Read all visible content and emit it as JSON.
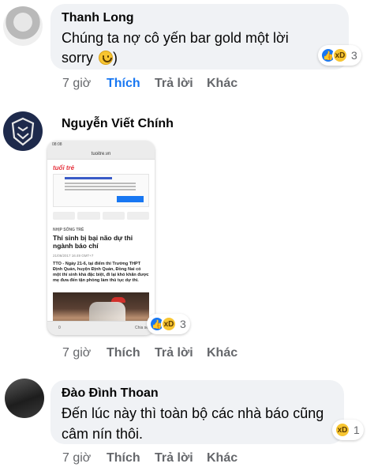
{
  "comments": [
    {
      "author": "Thanh Long",
      "text_line1": "Chúng ta nợ cô yến bar gold một lời",
      "text_line2": "sorry",
      "emoji": "slightly-smiling-face-icon",
      "reactions": [
        "like-icon",
        "haha-icon"
      ],
      "reaction_count": "3",
      "time": "7 giờ",
      "like_label": "Thích",
      "reply_label": "Trả lời",
      "more_label": "Khác",
      "liked": true
    },
    {
      "author": "Nguyễn Viết Chính",
      "reactions": [
        "like-icon",
        "haha-icon"
      ],
      "reaction_count": "3",
      "time": "7 giờ",
      "like_label": "Thích",
      "reply_label": "Trả lời",
      "more_label": "Khác",
      "liked": false,
      "attachment": {
        "status_time": "08:08",
        "url": "tuoitre.vn",
        "site_logo": "tuổi trẻ",
        "category": "NHỊP SỐNG TRẺ",
        "title": "Thí sinh bị bại não dự thi ngành báo chí",
        "date": "21/06/2017 16:49 GMT+7",
        "lead": "TTO - Ngày 21-6, tại điểm thi Trường THPT Định Quán, huyện Định Quán, Đồng Nai có một thí sinh khá đặc biệt, đi lại khó khăn được mẹ đưa đến tận phòng làm thủ tục dự thi.",
        "bar_like": "0",
        "bar_share": "Chia sẻ"
      }
    },
    {
      "author": "Đào Đình Thoan",
      "text_line1": "Đến lúc này thì toàn bộ các nhà báo cũng",
      "text_line2": "câm nín thôi.",
      "reactions": [
        "haha-icon"
      ],
      "reaction_count": "1",
      "time": "7 giờ",
      "like_label": "Thích",
      "reply_label": "Trả lời",
      "more_label": "Khác",
      "liked": false
    }
  ],
  "colors": {
    "bubble": "#f0f2f5",
    "meta_text": "#65676b",
    "like_blue": "#1877f2",
    "haha_yellow": "#f7c531"
  }
}
